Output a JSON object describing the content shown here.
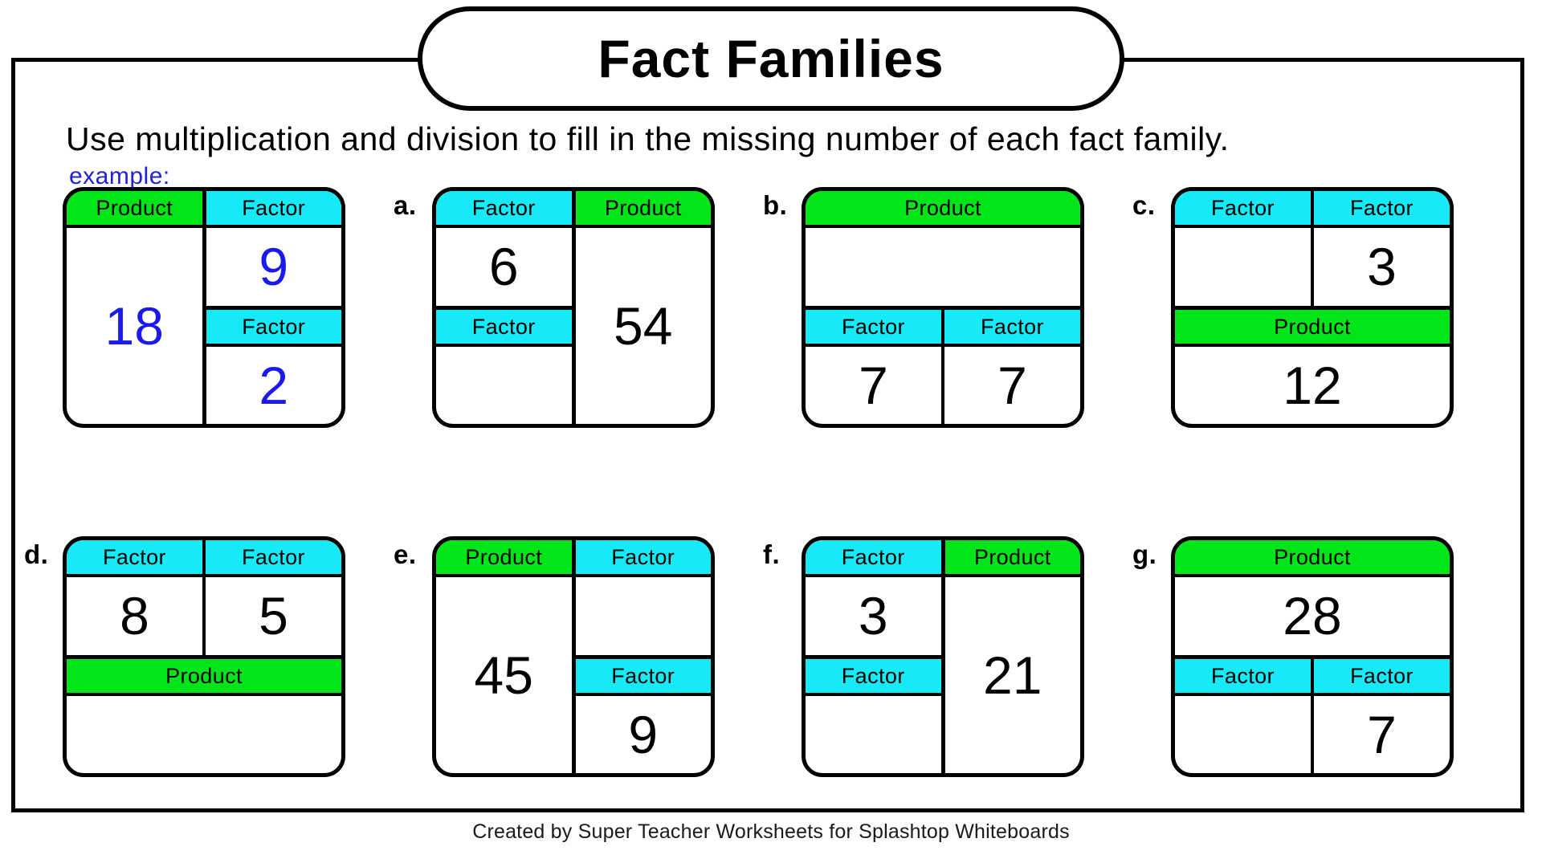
{
  "title": "Fact Families",
  "instructions": "Use multiplication and division to fill in the missing number of each fact family.",
  "example_label": "example:",
  "footer": "Created by Super Teacher Worksheets for Splashtop Whiteboards",
  "colors": {
    "factor_header": "#16eaf6",
    "product_header": "#00e519",
    "answer_text": "#1a1aee",
    "border": "#000000"
  },
  "labels": {
    "factor": "Factor",
    "product": "Product"
  },
  "problems": [
    {
      "id": "example",
      "label": "",
      "layout": "split-right",
      "left_header": "Product",
      "left_value": "18",
      "right_top_header": "Factor",
      "right_top_value": "9",
      "right_bottom_header": "Factor",
      "right_bottom_value": "2",
      "prefilled_style": "answer"
    },
    {
      "id": "a",
      "label": "a.",
      "layout": "split-left",
      "left_top_header": "Factor",
      "left_top_value": "6",
      "left_bottom_header": "Factor",
      "left_bottom_value": "",
      "right_header": "Product",
      "right_value": "54",
      "prefilled_style": "normal"
    },
    {
      "id": "b",
      "label": "b.",
      "layout": "top-product",
      "top_header": "Product",
      "top_value": "",
      "bottom_left_header": "Factor",
      "bottom_left_value": "7",
      "bottom_right_header": "Factor",
      "bottom_right_value": "7",
      "prefilled_style": "normal"
    },
    {
      "id": "c",
      "label": "c.",
      "layout": "bottom-product",
      "top_left_header": "Factor",
      "top_left_value": "",
      "top_right_header": "Factor",
      "top_right_value": "3",
      "bottom_header": "Product",
      "bottom_value": "12",
      "prefilled_style": "normal"
    },
    {
      "id": "d",
      "label": "d.",
      "layout": "bottom-product",
      "top_left_header": "Factor",
      "top_left_value": "8",
      "top_right_header": "Factor",
      "top_right_value": "5",
      "bottom_header": "Product",
      "bottom_value": "",
      "prefilled_style": "normal"
    },
    {
      "id": "e",
      "label": "e.",
      "layout": "split-right",
      "left_header": "Product",
      "left_value": "45",
      "right_top_header": "Factor",
      "right_top_value": "",
      "right_bottom_header": "Factor",
      "right_bottom_value": "9",
      "prefilled_style": "normal"
    },
    {
      "id": "f",
      "label": "f.",
      "layout": "split-left",
      "left_top_header": "Factor",
      "left_top_value": "3",
      "left_bottom_header": "Factor",
      "left_bottom_value": "",
      "right_header": "Product",
      "right_value": "21",
      "prefilled_style": "normal"
    },
    {
      "id": "g",
      "label": "g.",
      "layout": "top-product",
      "top_header": "Product",
      "top_value": "28",
      "bottom_left_header": "Factor",
      "bottom_left_value": "",
      "bottom_right_header": "Factor",
      "bottom_right_value": "7",
      "prefilled_style": "normal"
    }
  ]
}
